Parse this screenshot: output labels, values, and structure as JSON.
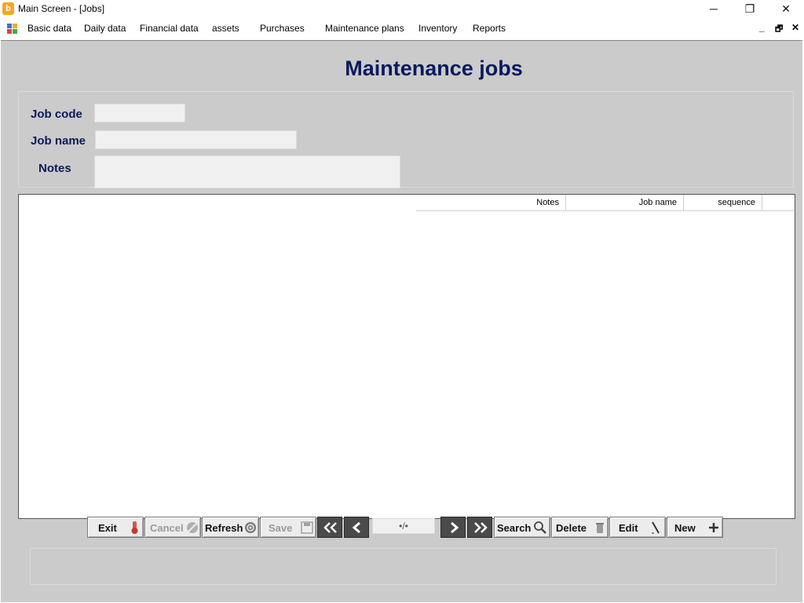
{
  "window": {
    "title": "Main Screen - [Jobs]",
    "app_icon": "app-logo-icon",
    "controls": {
      "minimize": "─",
      "maximize": "❐",
      "close": "✕"
    }
  },
  "menu": {
    "items": [
      {
        "label": "Basic data"
      },
      {
        "label": "Daily data"
      },
      {
        "label": "Financial data"
      },
      {
        "label": "assets"
      },
      {
        "label": "Purchases"
      },
      {
        "label": "Maintenance plans"
      },
      {
        "label": "Inventory"
      },
      {
        "label": "Reports"
      }
    ],
    "mdi_controls": {
      "minimize": "_",
      "restore": "🗗",
      "close": "✕"
    }
  },
  "form": {
    "title": "Maintenance jobs",
    "fields": {
      "job_code": {
        "label": "Job code",
        "value": ""
      },
      "job_name": {
        "label": "Job name",
        "value": ""
      },
      "notes": {
        "label": "Notes",
        "value": ""
      }
    }
  },
  "grid": {
    "columns": [
      "Notes",
      "Job name",
      "sequence"
    ],
    "rows": []
  },
  "toolbar": {
    "exit": "Exit",
    "cancel": "Cancel",
    "refresh": "Refresh",
    "save": "Save",
    "pager": "•/•",
    "search": "Search",
    "delete": "Delete",
    "edit": "Edit",
    "new": "New"
  },
  "colors": {
    "title_text": "#0a1a5c",
    "background": "#cbcbcb",
    "nav_button": "#4a4a4a"
  }
}
